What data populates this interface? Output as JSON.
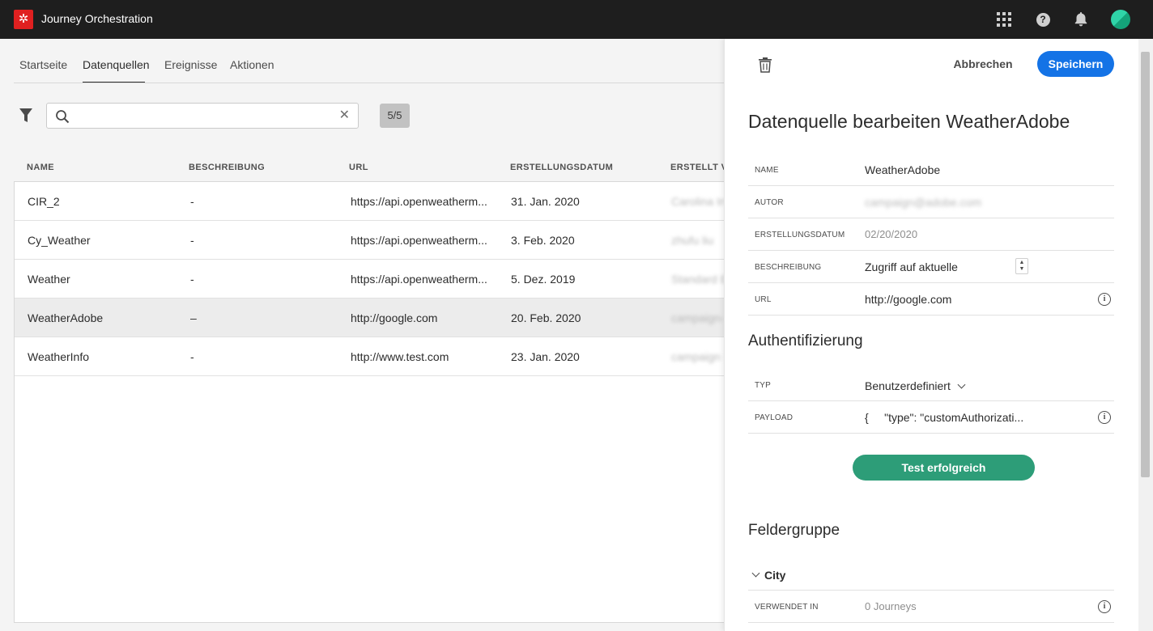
{
  "app": {
    "title": "Journey Orchestration",
    "logo_icon": "adobe-experience-logo",
    "brand_color": "#e02020"
  },
  "topbar": {
    "icons": [
      "apps-grid-icon",
      "help-icon",
      "notification-bell-icon",
      "user-avatar"
    ]
  },
  "tabs": [
    {
      "label": "Startseite",
      "active": false
    },
    {
      "label": "Datenquellen",
      "active": true
    },
    {
      "label": "Ereignisse",
      "active": false
    },
    {
      "label": "Aktionen",
      "active": false
    }
  ],
  "search": {
    "placeholder": "",
    "value": "",
    "count": "5/5"
  },
  "table": {
    "headers": [
      "NAME",
      "BESCHREIBUNG",
      "URL",
      "ERSTELLUNGSDATUM",
      "ERSTELLT VO"
    ],
    "rows": [
      {
        "name": "CIR_2",
        "description": "-",
        "url": "https://api.openweatherm...",
        "date": "31. Jan. 2020",
        "author": "Carolina Inf"
      },
      {
        "name": "Cy_Weather",
        "description": "-",
        "url": "https://api.openweatherm...",
        "date": "3. Feb. 2020",
        "author": "zhufu liu"
      },
      {
        "name": "Weather",
        "description": "-",
        "url": "https://api.openweatherm...",
        "date": "5. Dez. 2019",
        "author": "Standard Be"
      },
      {
        "name": "WeatherAdobe",
        "description": "–",
        "url": "http://google.com",
        "date": "20. Feb. 2020",
        "author": "campaign-k"
      },
      {
        "name": "WeatherInfo",
        "description": "-",
        "url": "http://www.test.com",
        "date": "23. Jan. 2020",
        "author": "campaign L"
      }
    ],
    "selected_row": 3
  },
  "panel": {
    "cancel_label": "Abbrechen",
    "save_label": "Speichern",
    "title": "Datenquelle bearbeiten WeatherAdobe",
    "fields": {
      "name_label": "NAME",
      "name_value": "WeatherAdobe",
      "author_label": "AUTOR",
      "author_value": "campaign@adobe.com",
      "date_label": "ERSTELLUNGSDATUM",
      "date_value": "02/20/2020",
      "description_label": "BESCHREIBUNG",
      "description_value": "Zugriff auf aktuelle",
      "url_label": "URL",
      "url_value": "http://google.com"
    },
    "auth": {
      "title": "Authentifizierung",
      "type_label": "TYP",
      "type_value": "Benutzerdefiniert",
      "payload_label": "PAYLOAD",
      "payload_value": "{     \"type\": \"customAuthorizati..."
    },
    "test_button": "Test erfolgreich",
    "field_group": {
      "title": "Feldergruppe",
      "group_name": "City",
      "used_in_label": "VERWENDET IN",
      "used_in_value": "0 Journeys"
    }
  },
  "colors": {
    "primary": "#1473e6",
    "success": "#2d9d78",
    "topbar": "#1e1e1e"
  }
}
